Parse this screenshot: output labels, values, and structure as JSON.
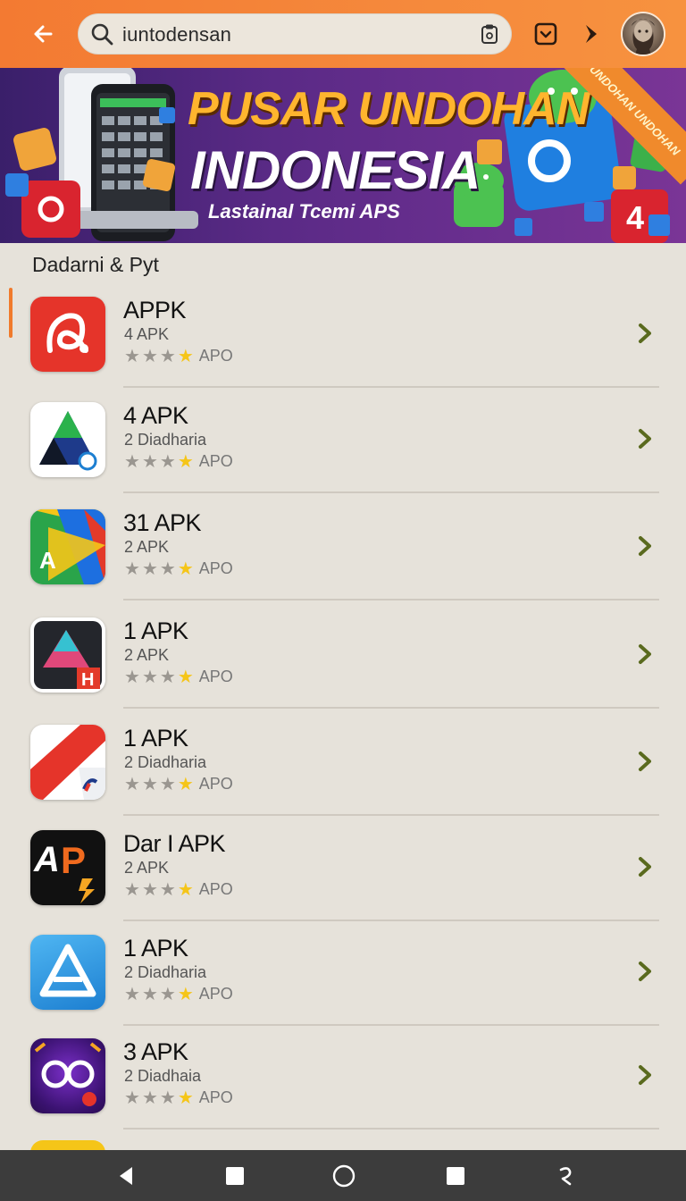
{
  "header": {
    "search_value": "iuntodensan",
    "icons": [
      "back-arrow-icon",
      "search-icon",
      "clipboard-icon",
      "download-box-icon",
      "forward-arrow-icon",
      "avatar"
    ]
  },
  "banner": {
    "title_line1": "PUSAR UNDOHAN",
    "title_line2": "INDONESIA",
    "subtitle": "Lastainal Tcemi APS",
    "ribbon": "UNDOHAN UNDOHAN"
  },
  "section": {
    "title": "Dadarni & Pyt"
  },
  "apps": [
    {
      "name": "APPK",
      "sub": "4 APK",
      "rating_label": "APO",
      "stars": 4
    },
    {
      "name": "4 APK",
      "sub": "2 Diadharia",
      "rating_label": "APO",
      "stars": 4
    },
    {
      "name": "31 APK",
      "sub": "2 APK",
      "rating_label": "APO",
      "stars": 4
    },
    {
      "name": "1 APK",
      "sub": "2 APK",
      "rating_label": "APO",
      "stars": 4
    },
    {
      "name": "1 APK",
      "sub": "2 Diadharia",
      "rating_label": "APO",
      "stars": 4
    },
    {
      "name": "Dar I APK",
      "sub": "2 APK",
      "rating_label": "APO",
      "stars": 4
    },
    {
      "name": "1 APK",
      "sub": "2 Diadharia",
      "rating_label": "APO",
      "stars": 4
    },
    {
      "name": "3 APK",
      "sub": "2 Diadhaia",
      "rating_label": "APO",
      "stars": 4
    }
  ],
  "colors": {
    "accent": "#f37a32",
    "chevron": "#5a6a1e",
    "star_on": "#f5c518",
    "star_off": "#9a9690"
  }
}
